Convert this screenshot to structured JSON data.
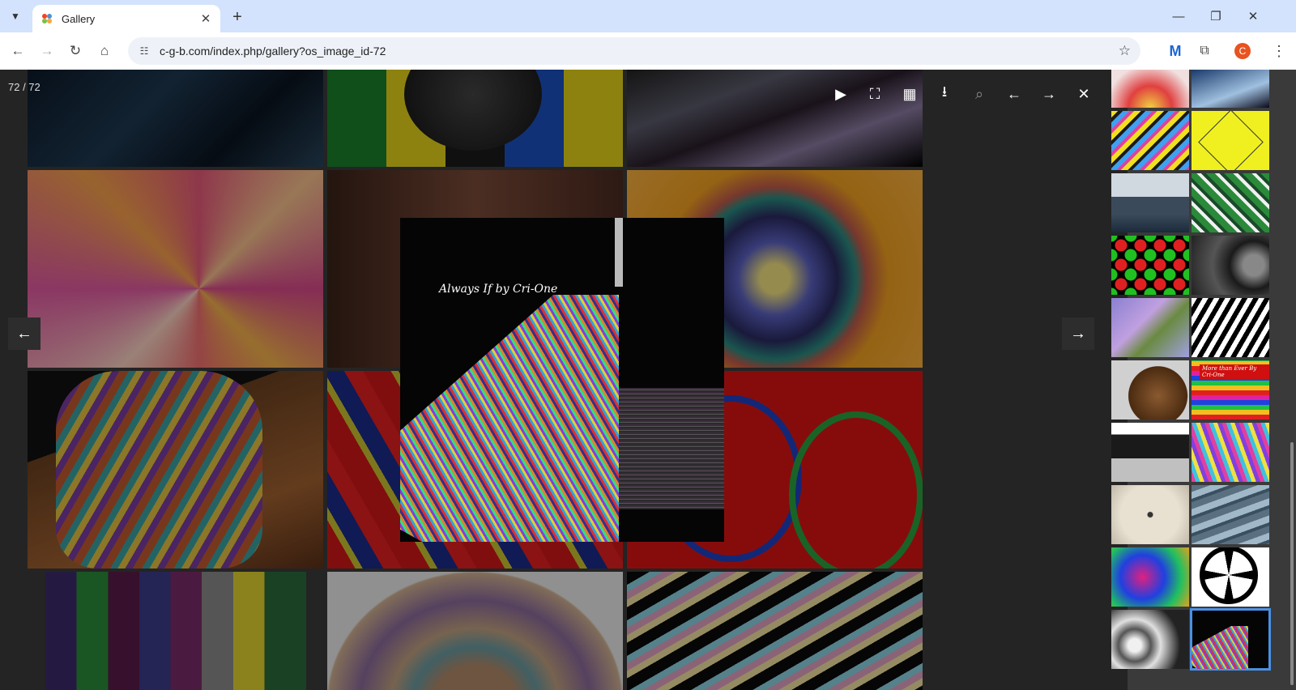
{
  "browser": {
    "tab_title": "Gallery",
    "url": "c-g-b.com/index.php/gallery?os_image_id-72",
    "profile_initial": "C"
  },
  "viewer": {
    "counter": "72 / 72",
    "caption": "Always If by Cri-One",
    "toolbar": {
      "play": "▶",
      "fullscreen": "⛶",
      "grid": "▦",
      "download": "⭳",
      "zoom": "⌕",
      "prev": "←",
      "next": "→",
      "close": "✕"
    }
  },
  "thumb_labels": {
    "t10": "More than Ever By Cri-One"
  },
  "colors": {
    "accent": "#4a90e2",
    "tab_strip": "#d3e3fd",
    "viewer_bg": "#3a3a3a"
  }
}
